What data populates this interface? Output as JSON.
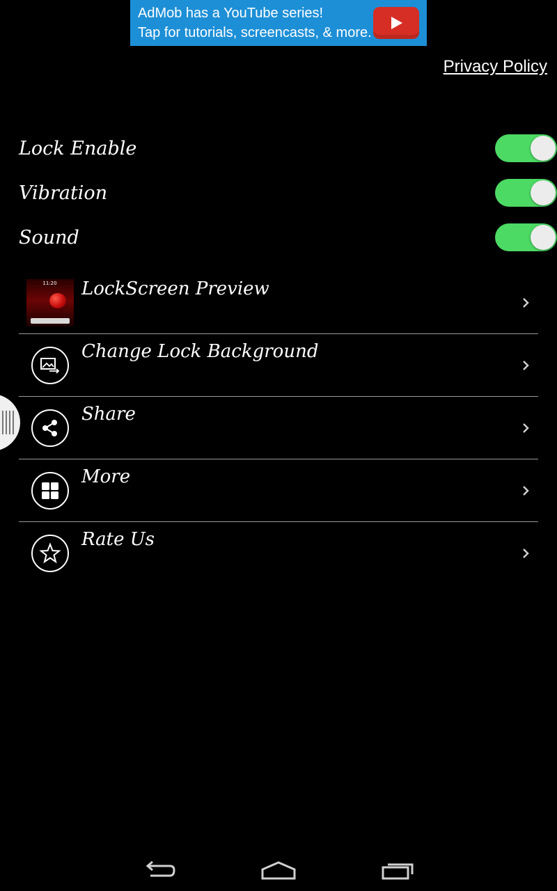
{
  "ad": {
    "line1": "AdMob has a YouTube series!",
    "line2": "Tap for tutorials, screencasts, & more.",
    "background_color": "#1d8fd6",
    "play_button_color": "#d62e25",
    "icon": "youtube-play-icon"
  },
  "privacy_policy": "Privacy Policy",
  "toggles": [
    {
      "label": "Lock Enable",
      "state": "on"
    },
    {
      "label": "Vibration",
      "state": "on"
    },
    {
      "label": "Sound",
      "state": "on"
    }
  ],
  "toggle_on_color": "#4cd964",
  "menu": [
    {
      "label": "LockScreen Preview",
      "icon": "lockscreen-preview-thumbnail"
    },
    {
      "label": "Change Lock Background",
      "icon": "image-swap-icon"
    },
    {
      "label": "Share",
      "icon": "share-icon"
    },
    {
      "label": "More",
      "icon": "grid-icon"
    },
    {
      "label": "Rate Us",
      "icon": "star-icon"
    }
  ],
  "preview_clock": "11:20",
  "navbar": {
    "buttons": [
      "back-icon",
      "home-icon",
      "recents-icon"
    ]
  }
}
